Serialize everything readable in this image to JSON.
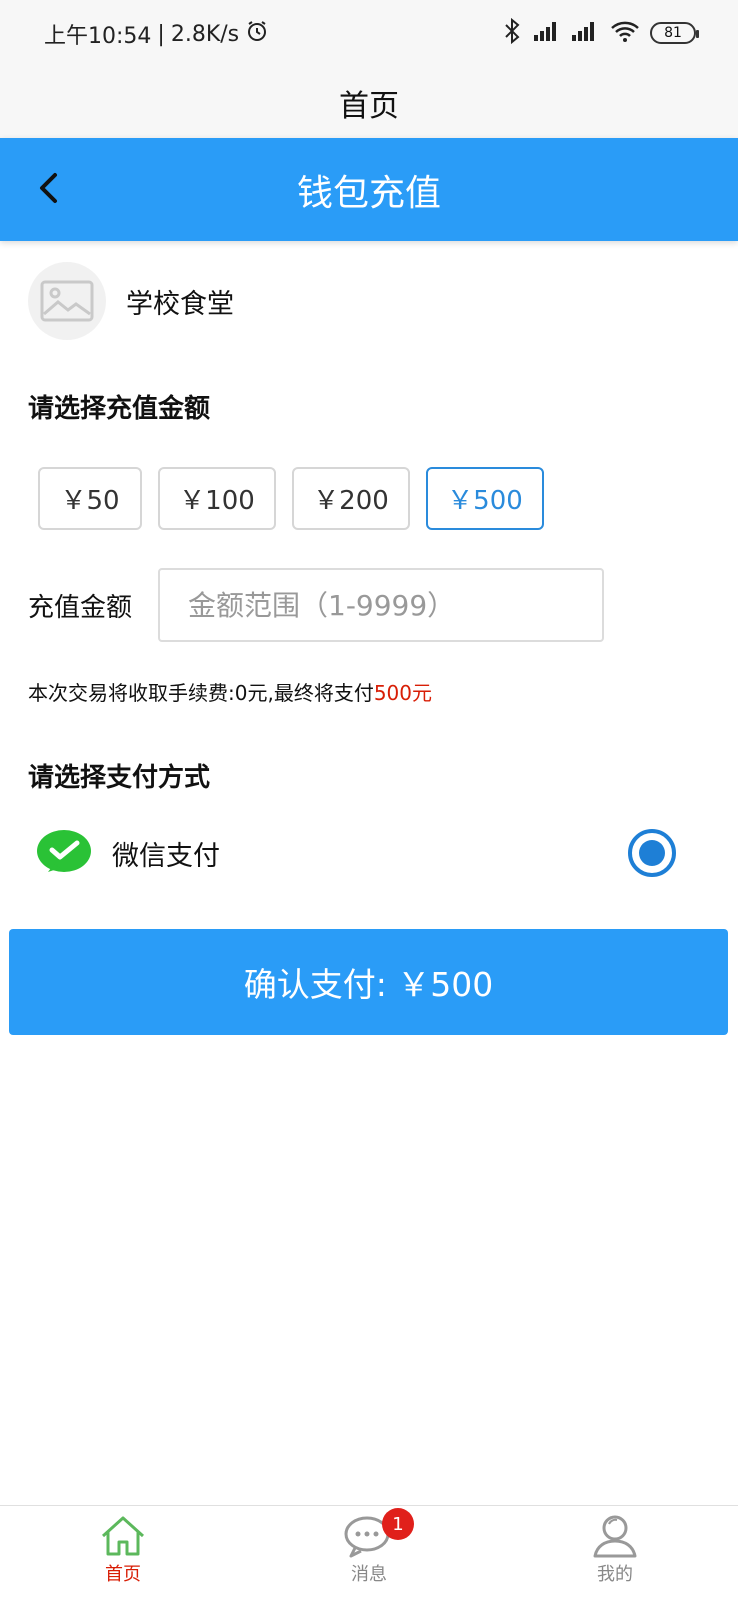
{
  "status_bar": {
    "time": "上午10:54",
    "network_speed": "2.8K/s",
    "battery": "81"
  },
  "app": {
    "title": "首页"
  },
  "header": {
    "title": "钱包充值"
  },
  "merchant": {
    "name": "学校食堂"
  },
  "amount_section": {
    "title": "请选择充值金额",
    "options": [
      "￥50",
      "￥100",
      "￥200",
      "￥500"
    ],
    "selected": "￥500"
  },
  "custom_amount": {
    "label": "充值金额",
    "placeholder": "金额范围（1-9999）"
  },
  "fee_note": {
    "text": "本次交易将收取手续费:0元,最终将支付",
    "amount": "500元"
  },
  "payment_section": {
    "title": "请选择支付方式",
    "method_label": "微信支付"
  },
  "confirm_button": {
    "label": "确认支付: ￥500"
  },
  "tab_bar": {
    "items": [
      {
        "label": "首页",
        "icon": "home-icon"
      },
      {
        "label": "消息",
        "icon": "message-icon",
        "badge": "1"
      },
      {
        "label": "我的",
        "icon": "user-icon"
      }
    ]
  },
  "colors": {
    "primary": "#2a9cf7",
    "selected_border": "#2a8bdc",
    "highlight_red": "#d81e06",
    "wechat_green": "#2ac236"
  }
}
